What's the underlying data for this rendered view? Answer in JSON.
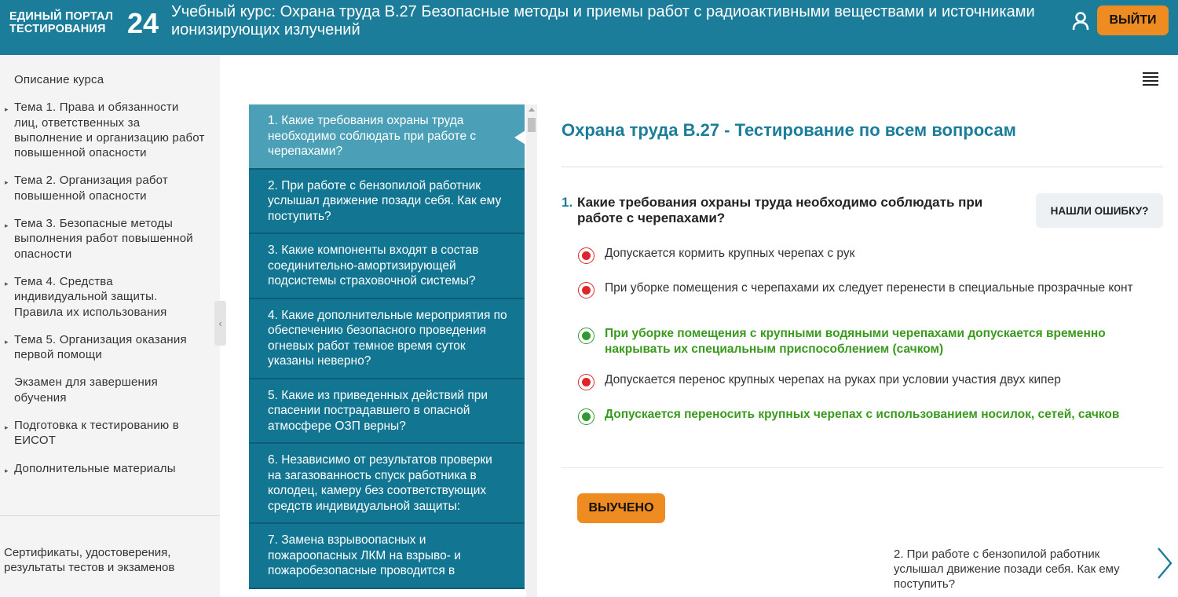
{
  "header": {
    "logo_text": "ЕДИНЫЙ ПОРТАЛ\nТЕСТИРОВАНИЯ",
    "logo_number": "24",
    "course_title": "Учебный курс: Охрана труда В.27 Безопасные методы и приемы работ с радиоактивными веществами и источниками ионизирующих излучений",
    "user_icon": "user-icon",
    "logout_label": "ВЫЙТИ",
    "color": "#1c7d9a",
    "accent": "#ef8c21"
  },
  "sidebar": {
    "items": [
      {
        "label": "Описание курса",
        "has_arrow": false
      },
      {
        "label": "Тема 1. Права и обязанности лиц, ответственных за выполнение и организацию работ повышенной опасности",
        "has_arrow": true
      },
      {
        "label": "Тема 2. Организация работ повышенной опасности",
        "has_arrow": true
      },
      {
        "label": "Тема 3. Безопасные методы выполнения работ повышенной опасности",
        "has_arrow": true
      },
      {
        "label": "Тема 4. Средства индивидуальной защиты. Правила их использования",
        "has_arrow": true
      },
      {
        "label": "Тема 5. Организация оказания первой помощи",
        "has_arrow": true
      },
      {
        "label": "Экзамен для завершения обучения",
        "has_arrow": false
      },
      {
        "label": "Подготовка к тестированию в ЕИСОТ",
        "has_arrow": true
      },
      {
        "label": "Дополнительные материалы",
        "has_arrow": true
      }
    ],
    "certificates_link": "Сертификаты, удостоверения, результаты тестов и экзаменов",
    "collapse_icon": "chevron-left-icon"
  },
  "question_list": [
    {
      "label": "1. Какие требования охраны труда необходимо соблюдать при работе с черепахами?",
      "active": true
    },
    {
      "label": "2. При работе с бензопилой работник услышал движение позади себя. Как ему поступить?",
      "active": false
    },
    {
      "label": "3. Какие компоненты входят в состав соединительно-амортизирующей подсистемы страховочной системы?",
      "active": false
    },
    {
      "label": "4. Какие дополнительные мероприятия по обеспечению безопасного проведения огневых работ темное время суток указаны неверно?",
      "active": false
    },
    {
      "label": "5. Какие из приведенных действий при спасении пострадавшего в опасной атмосфере ОЗП верны?",
      "active": false
    },
    {
      "label": "6. Независимо от результатов проверки на загазованность спуск работника в колодец, камеру без соответствующих средств индивидуальной защиты:",
      "active": false
    },
    {
      "label": "7. Замена взрывоопасных и пожароопасных ЛКМ на взрыво- и пожаробезопасные проводится в",
      "active": false
    }
  ],
  "main": {
    "menu_icon": "hamburger-menu-icon",
    "test_title": "Охрана труда В.27 - Тестирование по всем вопросам",
    "question_number": "1.",
    "question_text": "Какие требования охраны труда необходимо соблюдать при работе с черепахами?",
    "report_button": "НАШЛИ ОШИБКУ?",
    "answers": [
      {
        "text": "Допускается кормить крупных черепах с рук",
        "correct": false
      },
      {
        "text": "При уборке помещения с черепахами их следует перенести в специальные прозрачные конт",
        "correct": false
      },
      {
        "text": "При уборке помещения с крупными водяными черепахами допускается временно накрывать их специальным приспособлением (сачком)",
        "correct": true
      },
      {
        "text": "Допускается перенос крупных черепах на руках при условии участия двух кипер",
        "correct": false
      },
      {
        "text": "Допускается переносить крупных черепах с использованием носилок, сетей, сачков",
        "correct": true
      }
    ],
    "learned_button": "ВЫУЧЕНО",
    "next_question": "2. При работе с бензопилой работник услышал движение позади себя. Как ему поступить?",
    "next_icon": "chevron-right-icon",
    "wrong_color": "#e0252a",
    "right_color": "#2f9a2f"
  }
}
